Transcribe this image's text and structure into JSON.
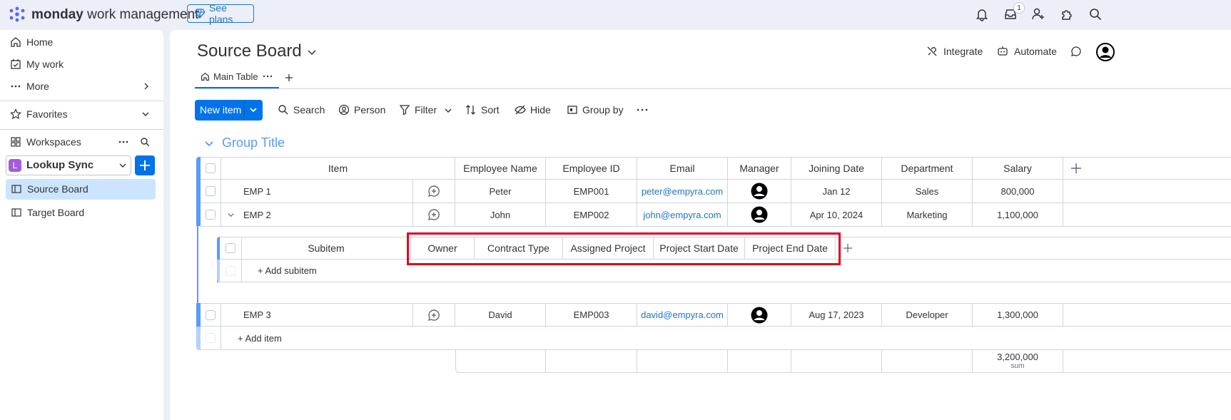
{
  "brand": {
    "bold": "monday",
    "rest": " work management"
  },
  "top_bar": {
    "see_plans": "See plans",
    "inbox_badge": "1"
  },
  "sidebar": {
    "nav": [
      {
        "label": "Home",
        "icon": "home-icon"
      },
      {
        "label": "My work",
        "icon": "calendar-check-icon"
      },
      {
        "label": "More",
        "icon": "ellipsis-icon"
      }
    ],
    "favorites": "Favorites",
    "workspaces": "Workspaces",
    "workspace": {
      "letter": "L",
      "name": "Lookup Sync"
    },
    "boards": [
      {
        "label": "Source Board",
        "active": true
      },
      {
        "label": "Target Board",
        "active": false
      }
    ]
  },
  "board": {
    "title": "Source Board",
    "tabs": [
      {
        "label": "Main Table"
      }
    ],
    "integrate": "Integrate",
    "automate": "Automate"
  },
  "toolbar": {
    "new_item": "New item",
    "search": "Search",
    "person": "Person",
    "filter": "Filter",
    "sort": "Sort",
    "hide": "Hide",
    "group_by": "Group by"
  },
  "group": {
    "title": "Group Title",
    "columns": [
      "Item",
      "Employee Name",
      "Employee ID",
      "Email",
      "Manager",
      "Joining Date",
      "Department",
      "Salary"
    ],
    "rows": [
      {
        "item": "EMP 1",
        "name": "Peter",
        "id": "EMP001",
        "email": "peter@empyra.com",
        "joining": "Jan 12",
        "department": "Sales",
        "salary": "800,000"
      },
      {
        "item": "EMP 2",
        "name": "John",
        "id": "EMP002",
        "email": "john@empyra.com",
        "joining": "Apr 10, 2024",
        "department": "Marketing",
        "salary": "1,100,000"
      },
      {
        "item": "EMP 3",
        "name": "David",
        "id": "EMP003",
        "email": "david@empyra.com",
        "joining": "Aug 17, 2023",
        "department": "Developer",
        "salary": "1,300,000"
      }
    ],
    "subitems": {
      "header": "Subitem",
      "columns": [
        "Owner",
        "Contract Type",
        "Assigned Project",
        "Project Start Date",
        "Project End Date"
      ],
      "add": "+ Add subitem"
    },
    "add_item": "+ Add item",
    "sum": {
      "value": "3,200,000",
      "label": "sum"
    }
  },
  "colors": {
    "accent": "#0073ea",
    "group": "#579bfc",
    "highlight_box": "#e2001a"
  }
}
